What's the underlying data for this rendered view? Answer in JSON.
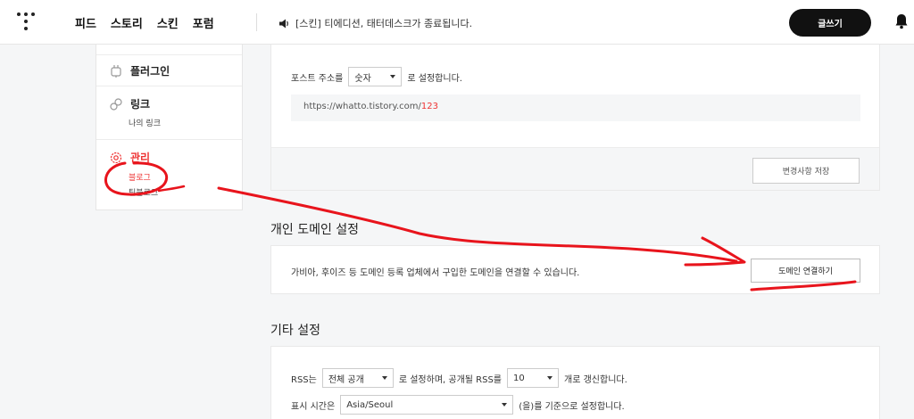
{
  "header": {
    "nav": [
      "피드",
      "스토리",
      "스킨",
      "포럼"
    ],
    "notice": "[스킨] 티에디션, 태터데스크가 종료됩니다.",
    "write_label": "글쓰기"
  },
  "sidebar": {
    "items": [
      {
        "label": "플러그인",
        "icon": "plug-icon"
      },
      {
        "label": "링크",
        "icon": "link-icon",
        "sub": [
          "나의 링크"
        ]
      },
      {
        "label": "관리",
        "icon": "gear-icon",
        "sub": [
          "블로그",
          "팀블로그"
        ]
      }
    ]
  },
  "post_address": {
    "prefix": "포스트 주소를",
    "select_value": "숫자",
    "suffix": "로 설정합니다.",
    "url_base": "https://whatto.tistory.com/",
    "url_num": "123",
    "save_label": "변경사항 저장"
  },
  "domain": {
    "title": "개인 도메인 설정",
    "desc": "가비아, 후이즈 등 도메인 등록 업체에서 구입한 도메인을 연결할 수 있습니다.",
    "button_label": "도메인 연결하기"
  },
  "etc": {
    "title": "기타 설정",
    "rss_prefix": "RSS는",
    "rss_select": "전체 공개",
    "rss_mid": "로 설정하며, 공개될 RSS를",
    "rss_count": "10",
    "rss_suffix": "개로 갱신합니다.",
    "time_prefix": "표시 시간은",
    "time_select": "Asia/Seoul",
    "time_suffix": "(을)를 기준으로 설정합니다."
  },
  "colors": {
    "accent": "#e33333",
    "annotation": "#e8141c"
  }
}
